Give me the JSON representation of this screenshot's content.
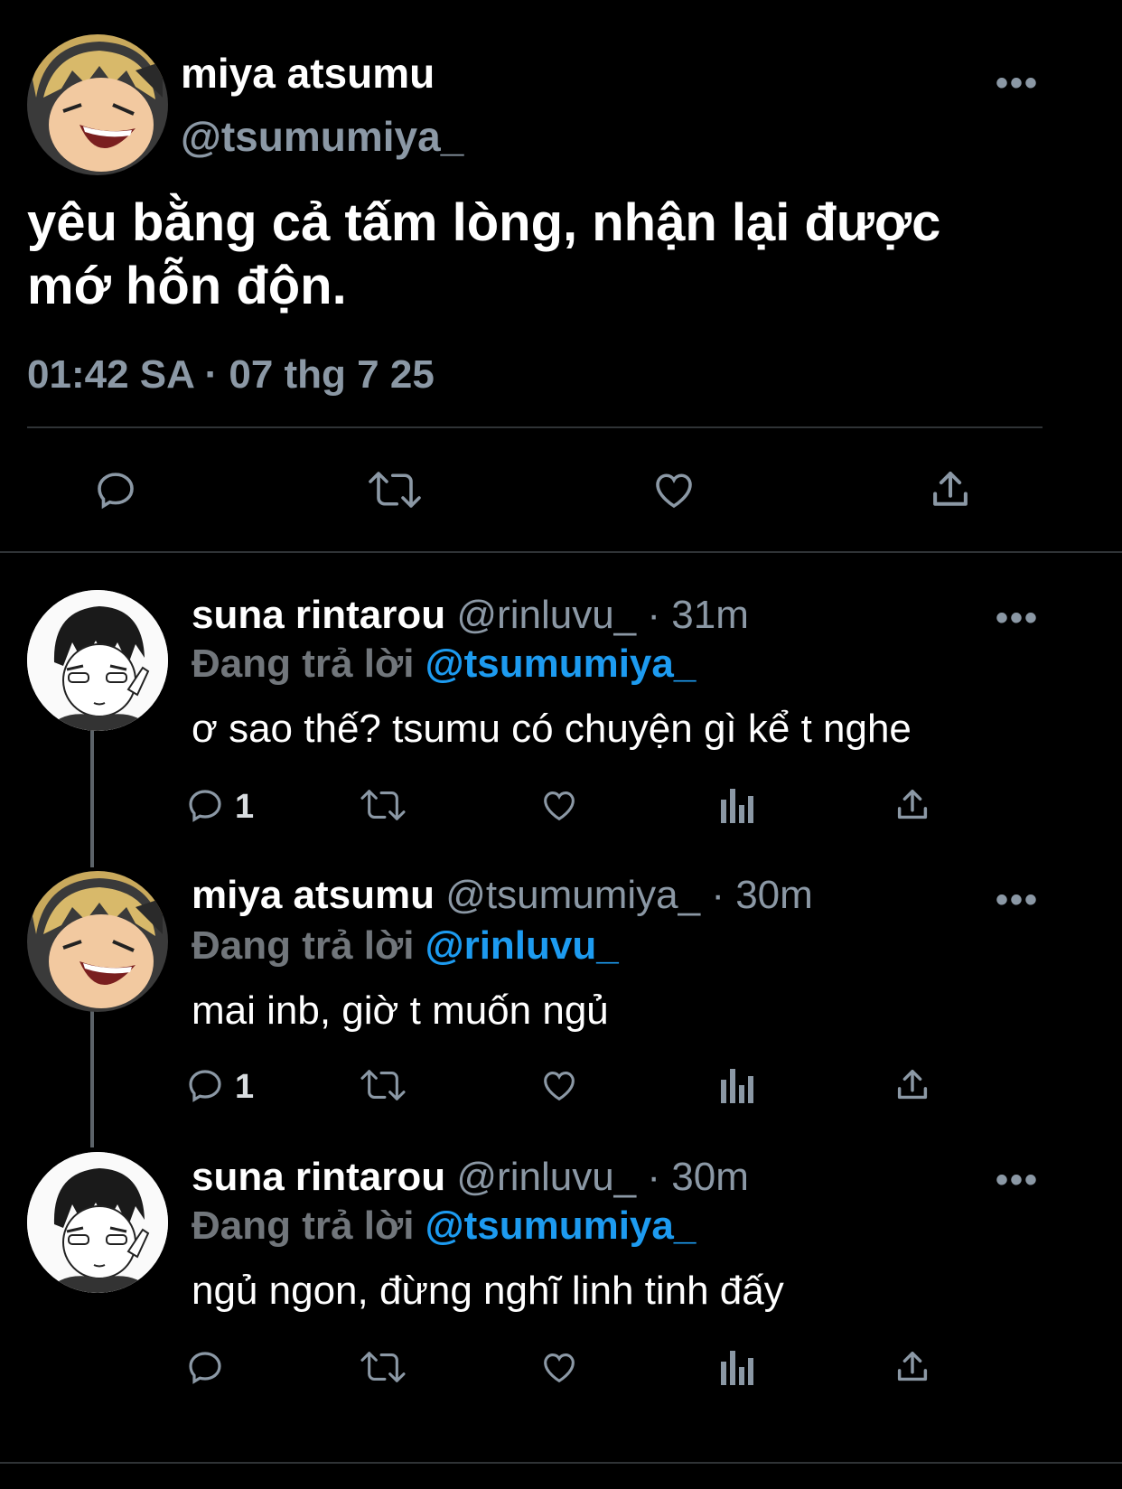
{
  "main_tweet": {
    "display_name": "miya atsumu",
    "handle": "@tsumumiya_",
    "more_label": "•••",
    "text_line1": "yêu bằng cả tấm lòng, nhận lại được",
    "text_line2": "mớ hỗn độn.",
    "timestamp": "01:42 SA · 07 thg 7 25",
    "actions": [
      "reply-icon",
      "retweet-icon",
      "like-icon",
      "share-icon"
    ]
  },
  "replies": [
    {
      "display_name": "suna rintarou",
      "handle": "@rinluvu_",
      "separator": "·",
      "time": "31m",
      "replying_prefix": "Đang trả lời",
      "replying_to": "@tsumumiya_",
      "text": "ơ sao thế? tsumu có chuyện gì kể t nghe",
      "reply_count": "1",
      "more_label": "•••",
      "avatar": "suna-avatar"
    },
    {
      "display_name": "miya atsumu",
      "handle": "@tsumumiya_",
      "separator": "·",
      "time": "30m",
      "replying_prefix": "Đang trả lời",
      "replying_to": "@rinluvu_",
      "text": "mai inb, giờ t muốn ngủ",
      "reply_count": "1",
      "more_label": "•••",
      "avatar": "atsumu-avatar"
    },
    {
      "display_name": "suna rintarou",
      "handle": "@rinluvu_",
      "separator": "·",
      "time": "30m",
      "replying_prefix": "Đang trả lời",
      "replying_to": "@tsumumiya_",
      "text": "ngủ ngon, đừng nghĩ linh tinh đấy",
      "reply_count": "",
      "more_label": "•••",
      "avatar": "suna-avatar"
    }
  ],
  "colors": {
    "background": "#000000",
    "text": "#ffffff",
    "secondary": "#8b98a5",
    "link": "#1d9bf0",
    "divider": "#2f3336"
  }
}
